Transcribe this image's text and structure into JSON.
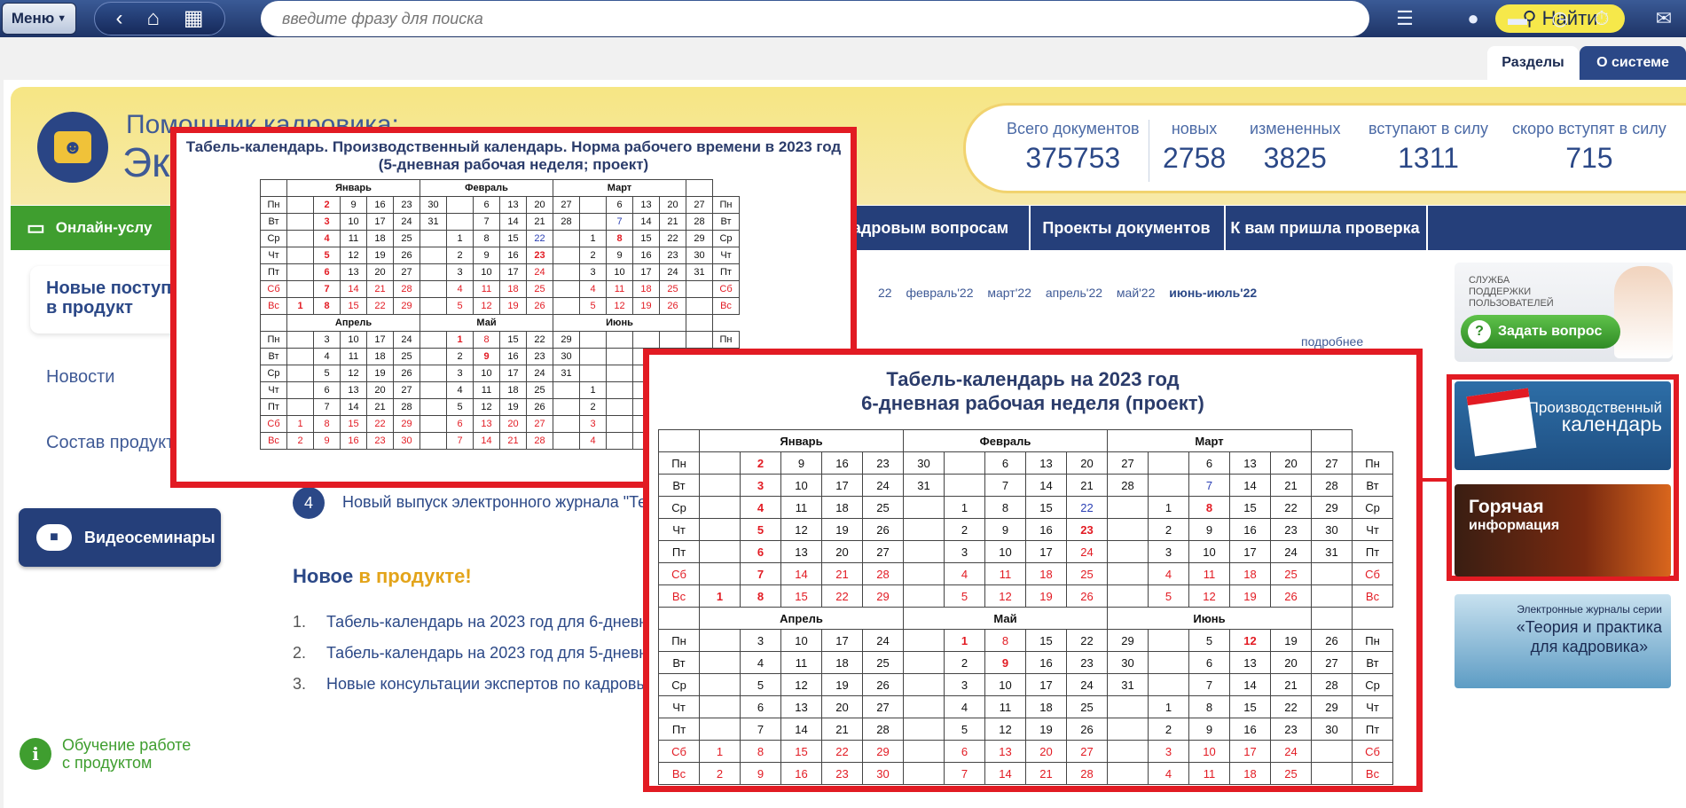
{
  "topbar": {
    "menu_label": "Меню",
    "search_placeholder": "введите фразу для поиска",
    "find_label": "Найти",
    "icons": [
      "back-arrow-icon",
      "home-icon",
      "grid-icon",
      "hamburger-icon",
      "user-icon",
      "folder-icon",
      "clock-icon",
      "stopwatch-icon",
      "message-icon"
    ]
  },
  "tabs": {
    "sections": "Разделы",
    "about": "О системе"
  },
  "brand": {
    "line1": "Помощник кадровика:",
    "line2": "Эк"
  },
  "stats": [
    {
      "label": "Всего документов",
      "value": "375753"
    },
    {
      "label": "новых",
      "value": "2758"
    },
    {
      "label": "измененных",
      "value": "3825"
    },
    {
      "label": "вступают в силу",
      "value": "1311"
    },
    {
      "label": "скоро вступят в силу",
      "value": "715"
    }
  ],
  "nav": {
    "online": "Онлайн-услу",
    "items": [
      "адровым вопросам",
      "Проекты документов",
      "К вам пришла проверка"
    ]
  },
  "left": {
    "card": "Новые поступ в продукт",
    "card_line1": "Новые поступ",
    "card_line2": "в продукт",
    "news": "Новости",
    "composition": "Состав продукт",
    "video": "Видеосеминары",
    "training_line1": "Обучение работе",
    "training_line2": "с продуктом"
  },
  "center": {
    "months": [
      "22",
      "февраль'22",
      "март'22",
      "апрель'22",
      "май'22",
      "июнь-июль'22"
    ],
    "more": "подробнее",
    "news4_num": "4",
    "news4_text": "Новый выпуск электронного журнала \"Те",
    "new_title_a": "Новое ",
    "new_title_b": "в продукте!",
    "list": [
      {
        "n": "1.",
        "text": "Табель-календарь на 2023 год для 6-дневн"
      },
      {
        "n": "2.",
        "text": "Табель-календарь на 2023 год для 5-дневн"
      },
      {
        "n": "3.",
        "text": "Новые консультации экспертов по кадровы"
      }
    ]
  },
  "right": {
    "support_text_1": "СЛУЖБА",
    "support_text_2": "ПОДДЕРЖКИ",
    "support_text_3": "ПОЛЬЗОВАТЕЛЕЙ",
    "ask": "Задать вопрос",
    "prodcal_1": "Производственный",
    "prodcal_2": "календарь",
    "hot_1": "Горячая",
    "hot_2": "информация",
    "journal_1": "Электронные журналы серии",
    "journal_2": "«Теория и практика",
    "journal_3": "для кадровика»"
  },
  "cal5": {
    "title": "Табель-календарь. Производственный календарь. Норма рабочего времени в 2023 год (5-дневная рабочая неделя; проект)",
    "q1_months": [
      "Январь",
      "Февраль",
      "Март"
    ],
    "q2_months": [
      "Апрель",
      "Май",
      "Июнь"
    ],
    "days": [
      "Пн",
      "Вт",
      "Ср",
      "Чт",
      "Пт",
      "Сб",
      "Вс"
    ],
    "q1_rows": [
      [
        "",
        "2",
        "9",
        "16",
        "23",
        "30",
        "",
        "6",
        "13",
        "20",
        "27",
        "",
        "6",
        "13",
        "20",
        "27"
      ],
      [
        "",
        "3",
        "10",
        "17",
        "24",
        "31",
        "",
        "7",
        "14",
        "21",
        "28",
        "",
        "7",
        "14",
        "21",
        "28"
      ],
      [
        "",
        "4",
        "11",
        "18",
        "25",
        "",
        "1",
        "8",
        "15",
        "22",
        "",
        "1",
        "8",
        "15",
        "22",
        "29"
      ],
      [
        "",
        "5",
        "12",
        "19",
        "26",
        "",
        "2",
        "9",
        "16",
        "23",
        "",
        "2",
        "9",
        "16",
        "23",
        "30"
      ],
      [
        "",
        "6",
        "13",
        "20",
        "27",
        "",
        "3",
        "10",
        "17",
        "24",
        "",
        "3",
        "10",
        "17",
        "24",
        "31"
      ],
      [
        "",
        "7",
        "14",
        "21",
        "28",
        "",
        "4",
        "11",
        "18",
        "25",
        "",
        "4",
        "11",
        "18",
        "25",
        ""
      ],
      [
        "1",
        "8",
        "15",
        "22",
        "29",
        "",
        "5",
        "12",
        "19",
        "26",
        "",
        "5",
        "12",
        "19",
        "26",
        ""
      ]
    ],
    "q2_rows": [
      [
        "",
        "3",
        "10",
        "17",
        "24",
        "",
        "1",
        "8",
        "15",
        "22",
        "29",
        "",
        "",
        "",
        "",
        ""
      ],
      [
        "",
        "4",
        "11",
        "18",
        "25",
        "",
        "2",
        "9",
        "16",
        "23",
        "30",
        "",
        "",
        "",
        "",
        ""
      ],
      [
        "",
        "5",
        "12",
        "19",
        "26",
        "",
        "3",
        "10",
        "17",
        "24",
        "31",
        "",
        "",
        "",
        "",
        ""
      ],
      [
        "",
        "6",
        "13",
        "20",
        "27",
        "",
        "4",
        "11",
        "18",
        "25",
        "",
        "1",
        "",
        "",
        "",
        ""
      ],
      [
        "",
        "7",
        "14",
        "21",
        "28",
        "",
        "5",
        "12",
        "19",
        "26",
        "",
        "2",
        "",
        "",
        "",
        ""
      ],
      [
        "1",
        "8",
        "15",
        "22",
        "29",
        "",
        "6",
        "13",
        "20",
        "27",
        "",
        "3",
        "",
        "",
        "",
        ""
      ],
      [
        "2",
        "9",
        "16",
        "23",
        "30",
        "",
        "7",
        "14",
        "21",
        "28",
        "",
        "4",
        "",
        "",
        "",
        ""
      ]
    ]
  },
  "cal6": {
    "title_line1": "Табель-календарь на 2023 год",
    "title_line2": "6-дневная рабочая неделя (проект)",
    "q1_months": [
      "Январь",
      "Февраль",
      "Март"
    ],
    "q2_months": [
      "Апрель",
      "Май",
      "Июнь"
    ],
    "days": [
      "Пн",
      "Вт",
      "Ср",
      "Чт",
      "Пт",
      "Сб",
      "Вс"
    ],
    "q1_rows": [
      [
        "",
        "2",
        "9",
        "16",
        "23",
        "30",
        "",
        "6",
        "13",
        "20",
        "27",
        "",
        "6",
        "13",
        "20",
        "27"
      ],
      [
        "",
        "3",
        "10",
        "17",
        "24",
        "31",
        "",
        "7",
        "14",
        "21",
        "28",
        "",
        "7",
        "14",
        "21",
        "28"
      ],
      [
        "",
        "4",
        "11",
        "18",
        "25",
        "",
        "1",
        "8",
        "15",
        "22",
        "",
        "1",
        "8",
        "15",
        "22",
        "29"
      ],
      [
        "",
        "5",
        "12",
        "19",
        "26",
        "",
        "2",
        "9",
        "16",
        "23",
        "",
        "2",
        "9",
        "16",
        "23",
        "30"
      ],
      [
        "",
        "6",
        "13",
        "20",
        "27",
        "",
        "3",
        "10",
        "17",
        "24",
        "",
        "3",
        "10",
        "17",
        "24",
        "31"
      ],
      [
        "",
        "7",
        "14",
        "21",
        "28",
        "",
        "4",
        "11",
        "18",
        "25",
        "",
        "4",
        "11",
        "18",
        "25",
        ""
      ],
      [
        "1",
        "8",
        "15",
        "22",
        "29",
        "",
        "5",
        "12",
        "19",
        "26",
        "",
        "5",
        "12",
        "19",
        "26",
        ""
      ]
    ],
    "q2_rows": [
      [
        "",
        "3",
        "10",
        "17",
        "24",
        "",
        "1",
        "8",
        "15",
        "22",
        "29",
        "",
        "5",
        "12",
        "19",
        "26"
      ],
      [
        "",
        "4",
        "11",
        "18",
        "25",
        "",
        "2",
        "9",
        "16",
        "23",
        "30",
        "",
        "6",
        "13",
        "20",
        "27"
      ],
      [
        "",
        "5",
        "12",
        "19",
        "26",
        "",
        "3",
        "10",
        "17",
        "24",
        "31",
        "",
        "7",
        "14",
        "21",
        "28"
      ],
      [
        "",
        "6",
        "13",
        "20",
        "27",
        "",
        "4",
        "11",
        "18",
        "25",
        "",
        "1",
        "8",
        "15",
        "22",
        "29"
      ],
      [
        "",
        "7",
        "14",
        "21",
        "28",
        "",
        "5",
        "12",
        "19",
        "26",
        "",
        "2",
        "9",
        "16",
        "23",
        "30"
      ],
      [
        "1",
        "8",
        "15",
        "22",
        "29",
        "",
        "6",
        "13",
        "20",
        "27",
        "",
        "3",
        "10",
        "17",
        "24",
        ""
      ],
      [
        "2",
        "9",
        "16",
        "23",
        "30",
        "",
        "7",
        "14",
        "21",
        "28",
        "",
        "4",
        "11",
        "18",
        "25",
        ""
      ]
    ]
  },
  "colors": {
    "accent": "#253f7a",
    "red": "#e21b23",
    "green": "#3f9e2f",
    "yellow": "#f6e84a"
  }
}
